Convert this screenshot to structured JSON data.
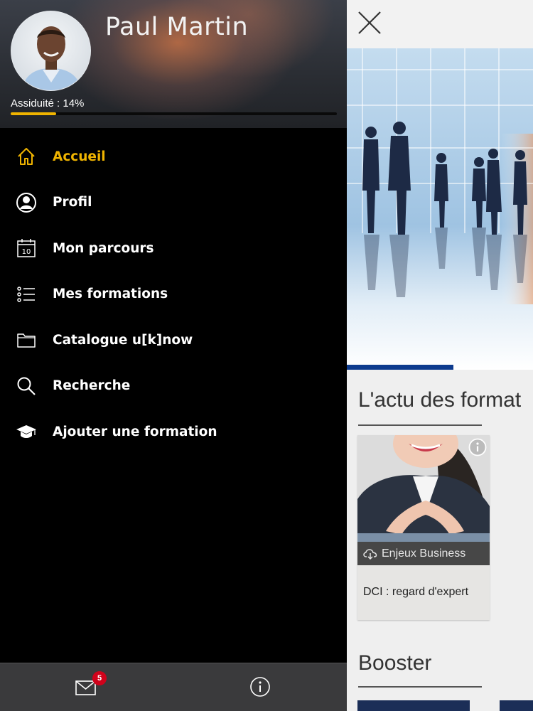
{
  "drawer": {
    "user_name": "Paul Martin",
    "assiduite_label": "Assiduité : 14%",
    "assiduite_percent": 14,
    "accent_color": "#f0b400",
    "menu": [
      {
        "label": "Accueil",
        "icon": "home-icon",
        "active": true
      },
      {
        "label": "Profil",
        "icon": "profile-icon",
        "active": false
      },
      {
        "label": "Mon parcours",
        "icon": "calendar-icon",
        "calendar_day": "10",
        "active": false
      },
      {
        "label": "Mes formations",
        "icon": "list-icon",
        "active": false
      },
      {
        "label": "Catalogue u[k]now",
        "icon": "folder-icon",
        "active": false
      },
      {
        "label": "Recherche",
        "icon": "search-icon",
        "active": false
      },
      {
        "label": "Ajouter une formation",
        "icon": "graduation-cap-icon",
        "active": false
      }
    ],
    "bottom_bar": {
      "mail_badge_count": "5",
      "badge_color": "#d0021b"
    }
  },
  "panel": {
    "section1_title": "L'actu des format",
    "card": {
      "tag": "Enjeux Business",
      "title": "DCI : regard d'expert"
    },
    "section2_title": "Booster",
    "underline_color": "#0d3b8e"
  }
}
